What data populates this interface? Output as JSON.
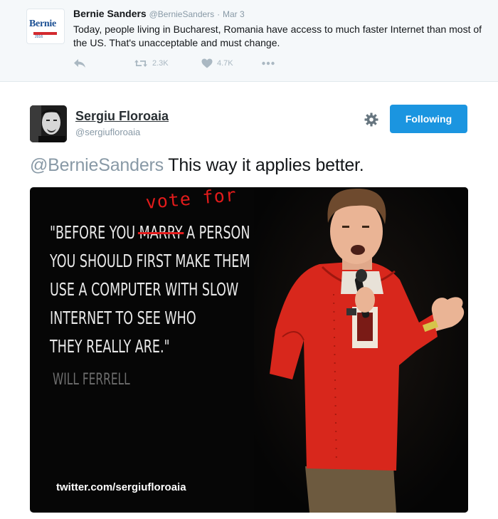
{
  "quoted_tweet": {
    "author_name": "Bernie Sanders",
    "author_handle": "@BernieSanders",
    "separator": "·",
    "date": "Mar 3",
    "text": "Today, people living in Bucharest, Romania have access to much faster Internet than most of the US. That's unacceptable and must change.",
    "retweet_count": "2.3K",
    "like_count": "4.7K",
    "avatar_logo_text": "Bernie",
    "avatar_logo_year": "2016"
  },
  "tweet": {
    "author_name": "Sergiu Floroaia",
    "author_handle": "@sergiufloroaia",
    "follow_button_label": "Following",
    "mention": "@BernieSanders",
    "text": " This way it applies better."
  },
  "media": {
    "quote_line_1_prefix": "\"BEFORE YOU ",
    "quote_line_1_struck": "MARRY",
    "quote_line_1_suffix": " A PERSON",
    "quote_line_2": "YOU SHOULD FIRST MAKE THEM",
    "quote_line_3": "USE A COMPUTER WITH SLOW",
    "quote_line_4": "INTERNET TO SEE WHO",
    "quote_line_5": "THEY REALLY ARE.\"",
    "attribution": "WILL FERRELL",
    "handwritten_correction": "vote for",
    "watermark": "twitter.com/sergiufloroaia"
  },
  "icons": {
    "reply": "reply-icon",
    "retweet": "retweet-icon",
    "like": "heart-icon",
    "more": "more-icon",
    "settings": "gear-icon"
  },
  "colors": {
    "twitter_blue": "#1b95e0",
    "correction_red": "#e21b1b",
    "shirt_red": "#d8271c",
    "quoted_background": "#f5f8fa"
  }
}
